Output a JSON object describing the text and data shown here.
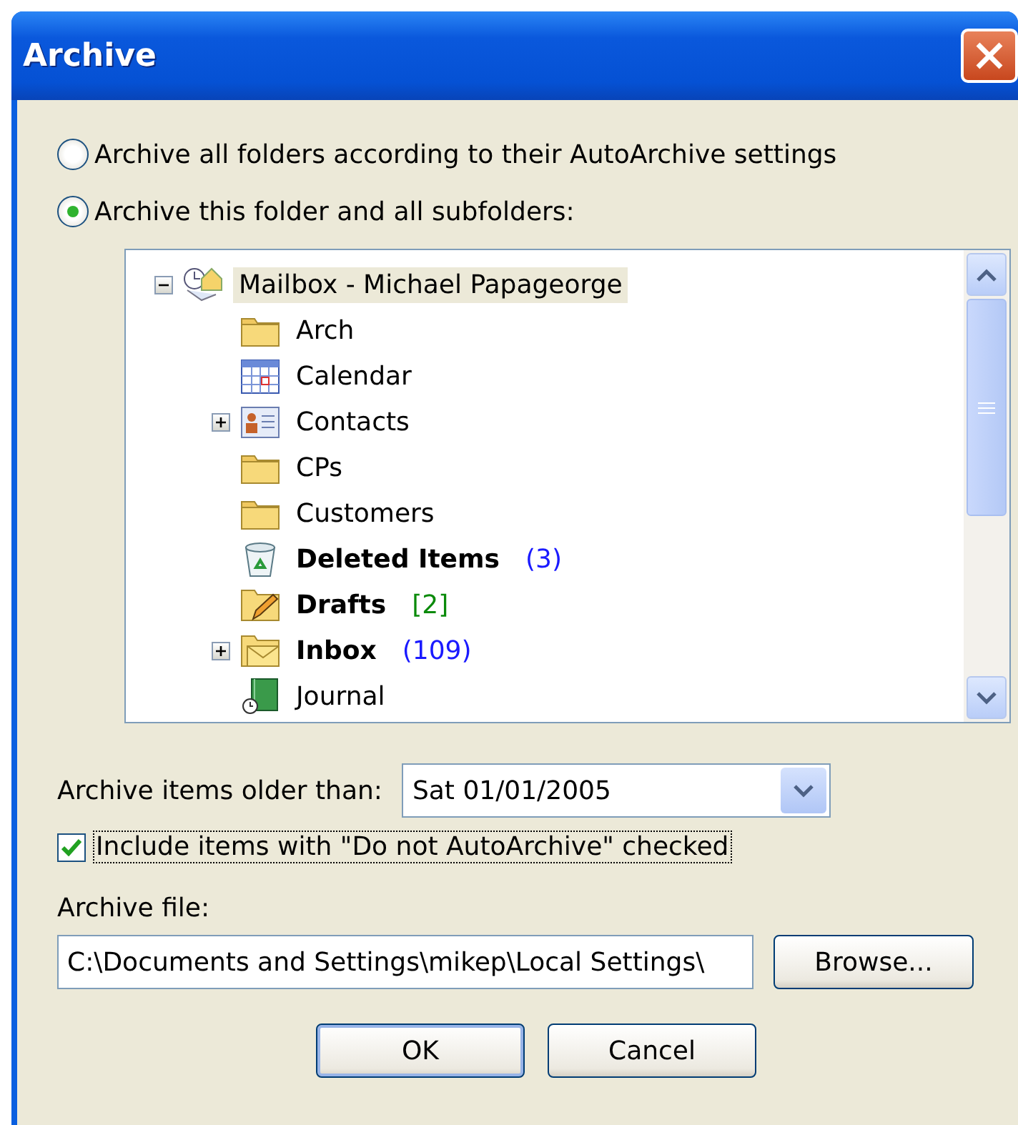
{
  "window": {
    "title": "Archive"
  },
  "scope_options": [
    {
      "label": "Archive all folders according to their AutoArchive settings",
      "selected": false
    },
    {
      "label": "Archive this folder and all subfolders:",
      "selected": true
    }
  ],
  "folder_tree": [
    {
      "label": "Mailbox - Michael Papageorge",
      "kind": "mailbox",
      "selected": true,
      "expanded": true,
      "children": [
        {
          "label": "Arch",
          "kind": "folder",
          "selected": false
        },
        {
          "label": "Calendar",
          "kind": "calendar",
          "selected": false
        },
        {
          "label": "Contacts",
          "kind": "contacts",
          "selected": false,
          "expanded": false
        },
        {
          "label": "CPs",
          "kind": "folder",
          "selected": false
        },
        {
          "label": "Customers",
          "kind": "folder",
          "selected": false
        },
        {
          "label": "Deleted Items",
          "kind": "trash",
          "selected": false,
          "bold": true,
          "count": "(3)",
          "color": "#1a1aff"
        },
        {
          "label": "Drafts",
          "kind": "drafts",
          "selected": false,
          "bold": true,
          "count": "[2]",
          "color": "#0a8a0a"
        },
        {
          "label": "Inbox",
          "kind": "inbox",
          "selected": false,
          "bold": true,
          "count": "(109)",
          "color": "#1a1aff",
          "expanded": false
        },
        {
          "label": "Journal",
          "kind": "journal",
          "selected": false
        }
      ]
    }
  ],
  "older_than": {
    "label": "Archive items older than:",
    "value": "Sat 01/01/2005"
  },
  "include_checkbox": {
    "label": "Include items with \"Do not AutoArchive\" checked",
    "checked": true
  },
  "archive_file": {
    "label": "Archive file:",
    "value": "C:\\Documents and Settings\\mikep\\Local Settings\\"
  },
  "browse_button": "Browse...",
  "buttons": [
    {
      "label": "OK",
      "default": true
    },
    {
      "label": "Cancel",
      "default": false
    }
  ]
}
